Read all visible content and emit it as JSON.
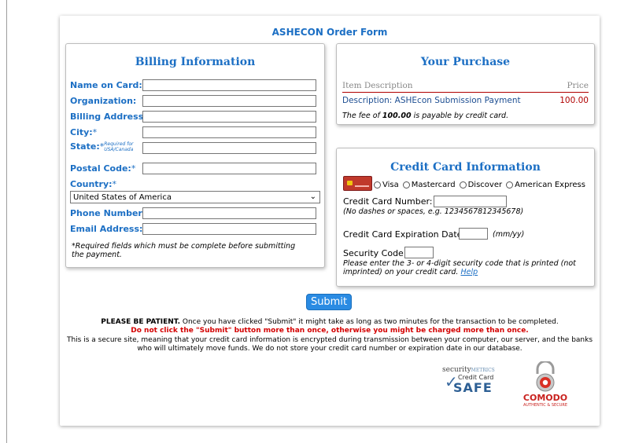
{
  "form": {
    "title": "ASHECON Order Form"
  },
  "billing": {
    "heading": "Billing Information",
    "fields": {
      "name_label": "Name on Card:",
      "org_label": "Organization:",
      "address_label": "Billing Address:",
      "city_label": "City:",
      "state_label": "State:",
      "state_note": "Required for USA/Canada",
      "postal_label": "Postal Code:",
      "country_label": "Country:",
      "phone_label": "Phone Number:",
      "email_label": "Email Address:",
      "required_mark": "*"
    },
    "country_selected": "United States of America",
    "required_note": "*Required fields which must be complete before submitting the payment."
  },
  "purchase": {
    "heading": "Your Purchase",
    "col_item": "Item Description",
    "col_price": "Price",
    "item_desc": "Description: ASHEcon Submission Payment",
    "item_price": "100.00",
    "fee_prefix": "The fee of ",
    "fee_amount": "100.00",
    "fee_suffix": " is payable by credit card."
  },
  "credit": {
    "heading": "Credit Card Information",
    "options": [
      "Visa",
      "Mastercard",
      "Discover",
      "American Express"
    ],
    "number_label": "Credit Card Number:",
    "number_hint": "(No dashes or spaces, e.g. 1234567812345678)",
    "exp_label": "Credit Card Expiration Date:",
    "exp_hint": "(mm/yy)",
    "sec_label": "Security Code:",
    "sec_hint": "Please enter the 3- or 4-digit security code that is printed (not imprinted) on your credit card.",
    "help_link": "Help"
  },
  "submit": {
    "label": "Submit"
  },
  "messages": {
    "patience_bold": "PLEASE BE PATIENT.",
    "patience_text": " Once you have clicked \"Submit\" it might take as long as two minutes for the transaction to be completed.",
    "warning": "Do not click the \"Submit\" button more than once, otherwise you might be charged more than once.",
    "secure": "This is a secure site, meaning that your credit card information is encrypted during transmission between your computer, our server, and the banks who will ultimately move funds. We do not store your credit card number or expiration date in our database."
  },
  "logos": {
    "securitymetrics_top": "security",
    "securitymetrics_brand": "METRICS",
    "securitymetrics_line2": "Credit Card",
    "securitymetrics_line3": "SAFE",
    "comodo_name": "COMODO",
    "comodo_tag": "AUTHENTIC & SECURE"
  },
  "colors": {
    "accent": "#1c6fc4",
    "warning": "#d40000",
    "price": "#b00000",
    "button": "#2a8be3"
  }
}
